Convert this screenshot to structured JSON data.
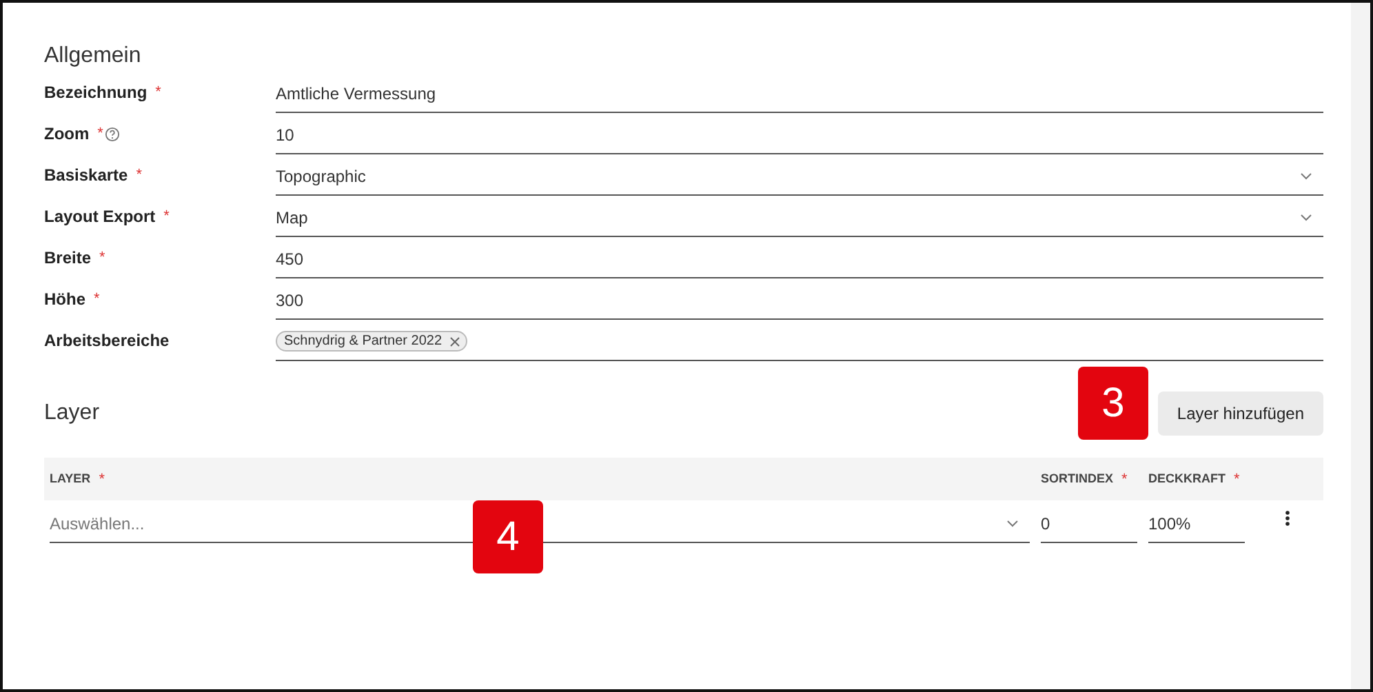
{
  "general": {
    "title": "Allgemein",
    "fields": [
      {
        "label": "Bezeichnung",
        "required_mark": "*",
        "kind": "text",
        "value": "Amtliche Vermessung"
      },
      {
        "label": "Zoom",
        "required_mark": "*",
        "help": true,
        "kind": "text",
        "value": "10"
      },
      {
        "label": "Basiskarte",
        "required_mark": "*",
        "kind": "select",
        "value": "Topographic"
      },
      {
        "label": "Layout Export",
        "required_mark": "*",
        "kind": "select",
        "value": "Map"
      },
      {
        "label": "Breite",
        "required_mark": "*",
        "kind": "text",
        "value": "450"
      },
      {
        "label": "Höhe",
        "required_mark": "*",
        "kind": "text",
        "value": "300"
      },
      {
        "label": "Arbeitsbereiche",
        "kind": "chips",
        "chips": [
          "Schnydrig & Partner 2022"
        ]
      }
    ]
  },
  "layers": {
    "title": "Layer",
    "add_button": "Layer hinzufügen",
    "columns": [
      {
        "label": "LAYER",
        "required_mark": "*"
      },
      {
        "label": "SORTINDEX",
        "required_mark": "*"
      },
      {
        "label": "DECKKRAFT",
        "required_mark": "*"
      }
    ],
    "rows": [
      {
        "layer_placeholder": "Auswählen...",
        "sortindex": "0",
        "opacity": "100%"
      }
    ]
  },
  "callouts": [
    "3",
    "4"
  ]
}
